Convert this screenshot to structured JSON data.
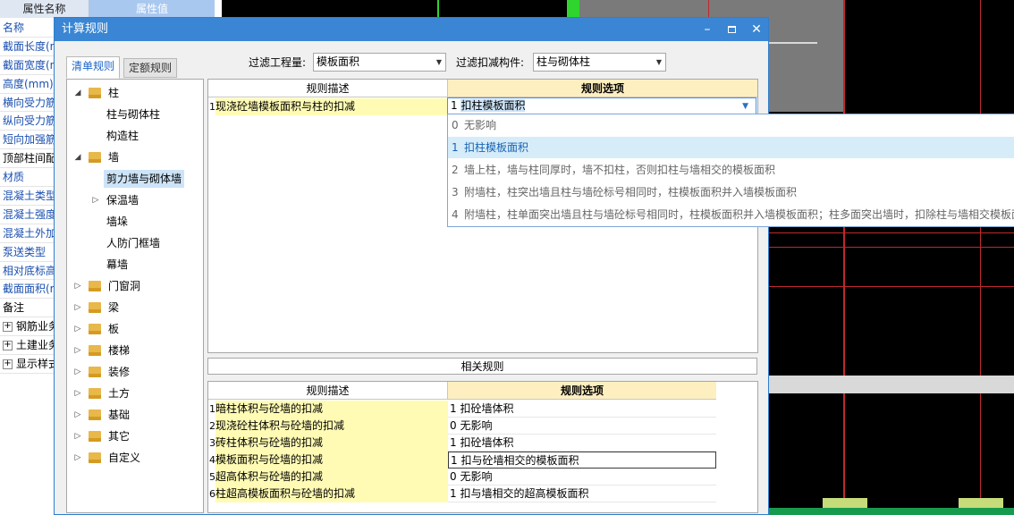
{
  "property_panel": {
    "header_name": "属性名称",
    "header_value": "属性值",
    "rows": [
      {
        "label": "名称",
        "style": "blue"
      },
      {
        "label": "截面长度(n",
        "style": "blue"
      },
      {
        "label": "截面宽度(n",
        "style": "blue"
      },
      {
        "label": "高度(mm)",
        "style": "blue"
      },
      {
        "label": "横向受力筋",
        "style": "blue"
      },
      {
        "label": "纵向受力筋",
        "style": "blue"
      },
      {
        "label": "短向加强筋",
        "style": "blue"
      },
      {
        "label": "顶部柱间配",
        "style": "black"
      },
      {
        "label": "材质",
        "style": "blue"
      },
      {
        "label": "混凝土类型",
        "style": "blue"
      },
      {
        "label": "混凝土强度",
        "style": "blue"
      },
      {
        "label": "混凝土外加",
        "style": "blue"
      },
      {
        "label": "泵送类型",
        "style": "blue"
      },
      {
        "label": "相对底标高",
        "style": "blue"
      },
      {
        "label": "截面面积(r",
        "style": "blue"
      },
      {
        "label": "备注",
        "style": "black"
      },
      {
        "label": "钢筋业务",
        "style": "black",
        "expandable": true
      },
      {
        "label": "土建业务",
        "style": "black",
        "expandable": true
      },
      {
        "label": "显示样式",
        "style": "black",
        "expandable": true
      }
    ]
  },
  "dialog": {
    "title": "计算规则",
    "minimize": "–",
    "maximize": "▫",
    "close": "✕",
    "tabs": [
      "清单规则",
      "定额规则"
    ],
    "active_tab": 0,
    "filter_qty_label": "过滤工程量:",
    "filter_qty_value": "模板面积",
    "filter_deduct_label": "过滤扣减构件:",
    "filter_deduct_value": "柱与砌体柱",
    "tree": [
      {
        "label": "柱",
        "folder": true,
        "expanded": true,
        "level": 0
      },
      {
        "label": "柱与砌体柱",
        "folder": false,
        "level": 1
      },
      {
        "label": "构造柱",
        "folder": false,
        "level": 1
      },
      {
        "label": "墙",
        "folder": true,
        "expanded": true,
        "level": 0
      },
      {
        "label": "剪力墙与砌体墙",
        "folder": false,
        "level": 1,
        "selected": true
      },
      {
        "label": "保温墙",
        "folder": false,
        "level": 1,
        "collapsed_child": true
      },
      {
        "label": "墙垛",
        "folder": false,
        "level": 1
      },
      {
        "label": "人防门框墙",
        "folder": false,
        "level": 1
      },
      {
        "label": "幕墙",
        "folder": false,
        "level": 1
      },
      {
        "label": "门窗洞",
        "folder": true,
        "expanded": false,
        "level": 0
      },
      {
        "label": "梁",
        "folder": true,
        "expanded": false,
        "level": 0
      },
      {
        "label": "板",
        "folder": true,
        "expanded": false,
        "level": 0
      },
      {
        "label": "楼梯",
        "folder": true,
        "expanded": false,
        "level": 0
      },
      {
        "label": "装修",
        "folder": true,
        "expanded": false,
        "level": 0
      },
      {
        "label": "土方",
        "folder": true,
        "expanded": false,
        "level": 0
      },
      {
        "label": "基础",
        "folder": true,
        "expanded": false,
        "level": 0
      },
      {
        "label": "其它",
        "folder": true,
        "expanded": false,
        "level": 0
      },
      {
        "label": "自定义",
        "folder": true,
        "expanded": false,
        "level": 0
      }
    ],
    "rules_header_desc": "规则描述",
    "rules_header_option": "规则选项",
    "rules": [
      {
        "num": "1",
        "desc": "现浇砼墙模板面积与柱的扣减",
        "option_num": "1",
        "option": "扣柱模板面积"
      }
    ],
    "dropdown_options": [
      {
        "num": "0",
        "text": "无影响"
      },
      {
        "num": "1",
        "text": "扣柱模板面积"
      },
      {
        "num": "2",
        "text": "墙上柱，墙与柱同厚时，墙不扣柱，否则扣柱与墙相交的模板面积"
      },
      {
        "num": "3",
        "text": "附墙柱，柱突出墙且柱与墙砼标号相同时，柱模板面积并入墙模板面积"
      },
      {
        "num": "4",
        "text": "附墙柱，柱单面突出墙且柱与墙砼标号相同时，柱模板面积并入墙模板面积；柱多面突出墙时，扣除柱与墙相交模板面"
      }
    ],
    "dropdown_highlight": 1,
    "related_title": "相关规则",
    "related_header_desc": "规则描述",
    "related_header_option": "规则选项",
    "related_rules": [
      {
        "num": "1",
        "desc": "暗柱体积与砼墙的扣减",
        "option": "1  扣砼墙体积"
      },
      {
        "num": "2",
        "desc": "现浇砼柱体积与砼墙的扣减",
        "option": "0   无影响"
      },
      {
        "num": "3",
        "desc": "砖柱体积与砼墙的扣减",
        "option": "1  扣砼墙体积"
      },
      {
        "num": "4",
        "desc": "模板面积与砼墙的扣减",
        "option": "1  扣与砼墙相交的模板面积",
        "boxed": true
      },
      {
        "num": "5",
        "desc": "超高体积与砼墙的扣减",
        "option": "0   无影响"
      },
      {
        "num": "6",
        "desc": "柱超高模板面积与砼墙的扣减",
        "option": "1  扣与墙相交的超高模板面积"
      }
    ]
  }
}
